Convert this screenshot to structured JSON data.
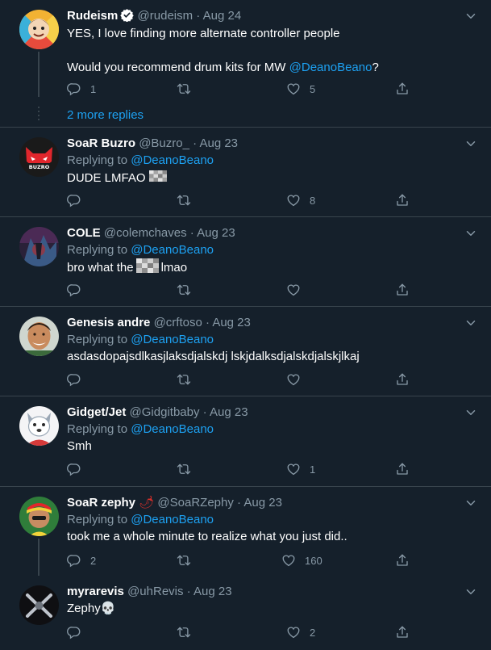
{
  "ui": {
    "accent": "#1da1f2",
    "background": "#15202b",
    "muted": "#8899a6",
    "icons": {
      "reply": "reply-icon",
      "retweet": "retweet-icon",
      "like": "like-icon",
      "share": "share-icon",
      "more": "chevron-down-icon",
      "verified": "verified-badge-icon"
    }
  },
  "tweets": [
    {
      "name": "Rudeism",
      "handle": "@rudeism",
      "sep": "·",
      "date": "Aug 24",
      "line1": "YES, I love finding more alternate controller people",
      "line2_prefix": "Would you recommend drum kits for MW ",
      "line2_mention": "@DeanoBeano",
      "line2_suffix": "?",
      "counts": {
        "reply": "1",
        "retweet": "",
        "like": "5"
      },
      "more_replies": "2 more replies"
    },
    {
      "name": "SoaR Buzro",
      "handle": "@Buzro_",
      "sep": "·",
      "date": "Aug 23",
      "replying_label": "Replying to ",
      "replying_to": "@DeanoBeano",
      "text": "DUDE LMFAO",
      "avatar_text": "BUZRO",
      "counts": {
        "reply": "",
        "retweet": "",
        "like": "8"
      }
    },
    {
      "name": "COLE",
      "handle": "@colemchaves",
      "sep": "·",
      "date": "Aug 23",
      "replying_label": "Replying to ",
      "replying_to": "@DeanoBeano",
      "text_before": "bro what the",
      "text_after": "lmao",
      "counts": {
        "reply": "",
        "retweet": "",
        "like": ""
      }
    },
    {
      "name": "Genesis andre",
      "handle": "@crftoso",
      "sep": "·",
      "date": "Aug 23",
      "replying_label": "Replying to ",
      "replying_to": "@DeanoBeano",
      "text": "asdasdopajsdlkasjlaksdjalskdj lskjdalksdjalskdjalskjlkaj",
      "counts": {
        "reply": "",
        "retweet": "",
        "like": ""
      }
    },
    {
      "name": "Gidget/Jet",
      "handle": "@Gidgitbaby",
      "sep": "·",
      "date": "Aug 23",
      "replying_label": "Replying to ",
      "replying_to": "@DeanoBeano",
      "text": "Smh",
      "counts": {
        "reply": "",
        "retweet": "",
        "like": "1"
      }
    },
    {
      "name": "SoaR zephy",
      "name_emoji": "🌶",
      "handle": "@SoaRZephy",
      "sep": "·",
      "date": "Aug 23",
      "replying_label": "Replying to ",
      "replying_to": "@DeanoBeano",
      "text": "took me a whole minute to realize what you just did..",
      "counts": {
        "reply": "2",
        "retweet": "",
        "like": "160"
      }
    },
    {
      "name": "myrarevis",
      "handle": "@uhRevis",
      "sep": "·",
      "date": "Aug 23",
      "text": "Zephy💀",
      "counts": {
        "reply": "",
        "retweet": "",
        "like": "2"
      }
    }
  ]
}
